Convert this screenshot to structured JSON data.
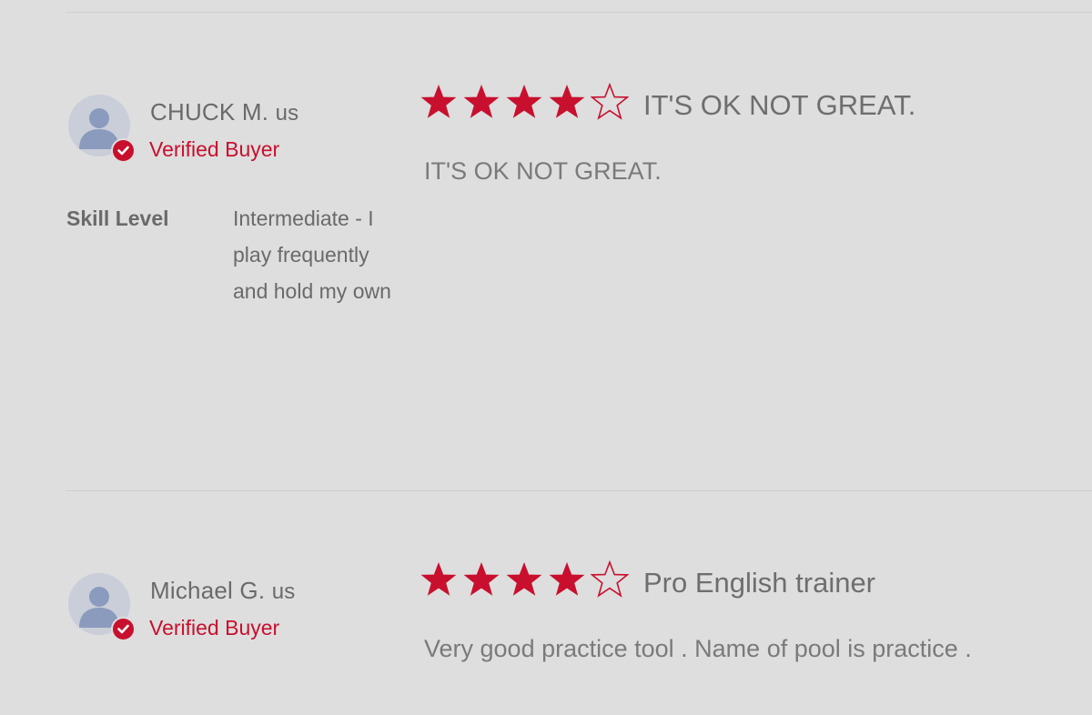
{
  "colors": {
    "background": "#dedede",
    "accent": "#c8102e",
    "text": "#6b6b6b",
    "avatar_bg": "#c9ced9",
    "avatar_figure": "#8a9bbd"
  },
  "reviews": [
    {
      "author": "CHUCK M.",
      "country": "us",
      "badge": "Verified Buyer",
      "badge_icon": "check-icon",
      "rating": 4,
      "rating_max": 5,
      "title": "IT'S OK NOT GREAT.",
      "body": "IT'S OK NOT GREAT.",
      "attributes": [
        {
          "label": "Skill Level",
          "value": "Intermediate - I play frequently and hold my own"
        }
      ]
    },
    {
      "author": "Michael G.",
      "country": "us",
      "badge": "Verified Buyer",
      "badge_icon": "check-icon",
      "rating": 4,
      "rating_max": 5,
      "title": "Pro English trainer",
      "body": "Very good practice tool . Name of pool is practice ."
    }
  ]
}
